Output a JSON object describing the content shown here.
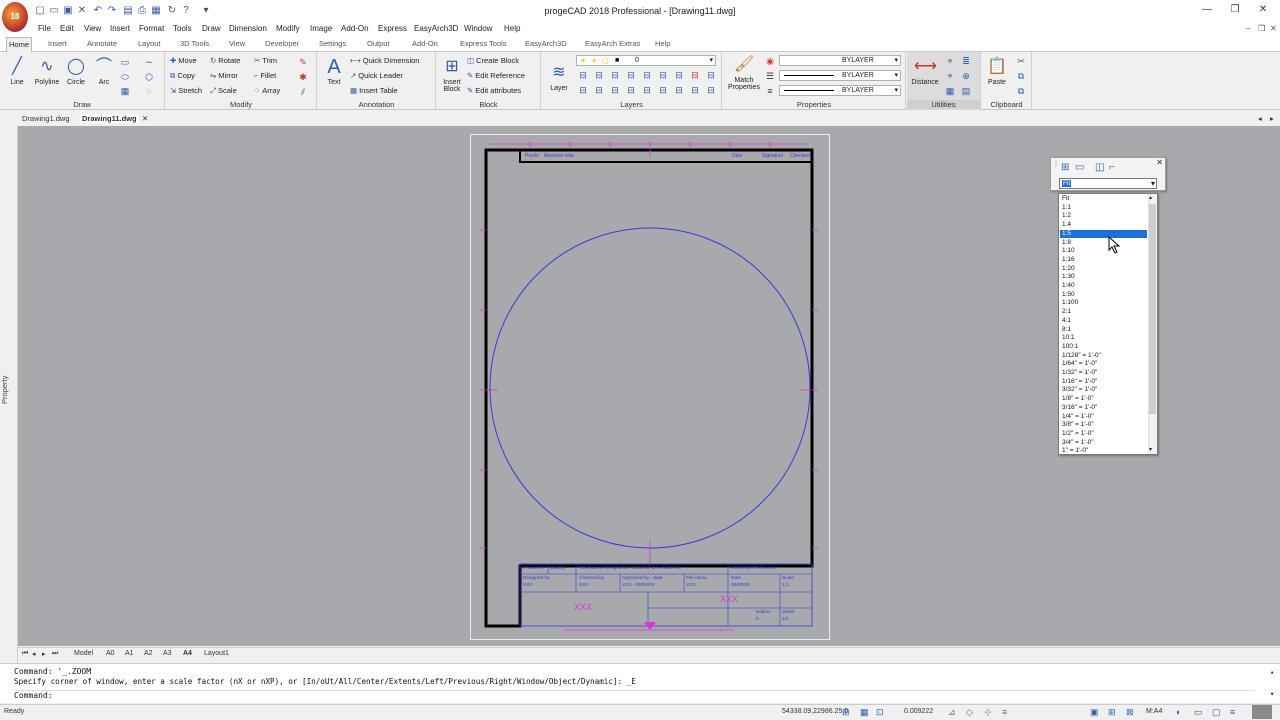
{
  "app": {
    "title": "progeCAD 2018 Professional - [Drawing11.dwg]",
    "logo_text": "18"
  },
  "menubar": [
    "File",
    "Edit",
    "View",
    "Insert",
    "Format",
    "Tools",
    "Draw",
    "Dimension",
    "Modify",
    "Image",
    "Add-On",
    "Express",
    "EasyArch3D",
    "Window",
    "Help"
  ],
  "ribbon_tabs": [
    "Home",
    "Insert",
    "Annotate",
    "Layout",
    "3D Tools",
    "View",
    "Developer",
    "Settings",
    "Output",
    "Add-On",
    "Express Tools",
    "EasyArch3D",
    "EasyArch Extras",
    "Help"
  ],
  "ribbon": {
    "draw": {
      "title": "Draw",
      "line": "Line",
      "polyline": "Polyline",
      "circle": "Circle",
      "arc": "Arc"
    },
    "modify": {
      "title": "Modify",
      "move": "Move",
      "rotate": "Rotate",
      "trim": "Trim",
      "copy": "Copy",
      "mirror": "Mirror",
      "fillet": "Fillet",
      "stretch": "Stretch",
      "scale": "Scale",
      "array": "Array"
    },
    "annotation": {
      "title": "Annotation",
      "text": "Text",
      "quick_dimension": "Quick Dimension",
      "quick_leader": "Quick Leader",
      "insert_table": "Insert Table"
    },
    "block": {
      "title": "Block",
      "insert_block_1": "Insert",
      "insert_block_2": "Block",
      "create_block": "Create Block",
      "edit_reference": "Edit Reference",
      "edit_attributes": "Edit attributes"
    },
    "layers": {
      "title": "Layers",
      "layer": "Layer",
      "current_layer": "0"
    },
    "properties": {
      "title": "Properties",
      "match_1": "Match",
      "match_2": "Properties",
      "color": "BYLAYER",
      "linetype": "BYLAYER",
      "lineweight": "BYLAYER"
    },
    "utilities": {
      "title": "Utilities",
      "distance": "Distance"
    },
    "clipboard": {
      "title": "Clipboard",
      "paste": "Paste"
    }
  },
  "doc_tabs": [
    "Drawing1.dwg",
    "Drawing11.dwg"
  ],
  "side_panel_label": "Property",
  "title_block": {
    "top_cells": [
      "Pos/lo",
      "Revision note",
      "Date",
      "Signature",
      "Checked"
    ],
    "row1": [
      "Prepared",
      "Quality",
      "Title/Name, designation, material, dimension etc",
      "Article No./Reference"
    ],
    "row2": [
      "Designed by",
      "Checked by",
      "Approved by - date",
      "File name",
      "Date",
      "Scale"
    ],
    "row2_values": [
      "XXX",
      "XXX",
      "XXX - 00/00/00",
      "XXX",
      "00/00/00",
      "1:1"
    ],
    "big_text_1": "XXX",
    "big_text_2": "XXX",
    "edition": "Edition",
    "edition_value": "0",
    "sheet": "Sheet",
    "sheet_value": "1/1"
  },
  "layout_tabs": [
    "Model",
    "A0",
    "A1",
    "A2",
    "A3",
    "A4",
    "Layout1"
  ],
  "command": {
    "line1": "Command: '_.ZOOM",
    "line2": "Specify corner of window, enter a scale factor (nX or nXP), or [In/oUt/All/Center/Extents/Left/Previous/Right/Window/Object/Dynamic]: _E",
    "prompt": "Command:"
  },
  "status": {
    "ready": "Ready",
    "coords": "54338.09,22986.25,0",
    "scale_value": "0.009222",
    "paper": "M:A4"
  },
  "viewport_toolbar": {
    "current_value": "Fit"
  },
  "scale_list": {
    "selected_index": 4,
    "options": [
      "Fit",
      "1:1",
      "1:2",
      "1:4",
      "1:5",
      "1:8",
      "1:10",
      "1:16",
      "1:20",
      "1:30",
      "1:40",
      "1:50",
      "1:100",
      "2:1",
      "4:1",
      "8:1",
      "10:1",
      "100:1",
      "1/128\" = 1'-0\"",
      "1/64\" = 1'-0\"",
      "1/32\" = 1'-0\"",
      "1/16\" = 1'-0\"",
      "3/32\" = 1'-0\"",
      "1/8\" = 1'-0\"",
      "3/16\" = 1'-0\"",
      "1/4\" = 1'-0\"",
      "3/8\" = 1'-0\"",
      "1/2\" = 1'-0\"",
      "3/4\" = 1'-0\"",
      "1\" = 1'-0\""
    ]
  },
  "colors": {
    "canvas": "#a7a9ad",
    "drawing_accent": "#d63ad6",
    "circle": "#3a3ad6",
    "selection": "#1e6fd6"
  }
}
